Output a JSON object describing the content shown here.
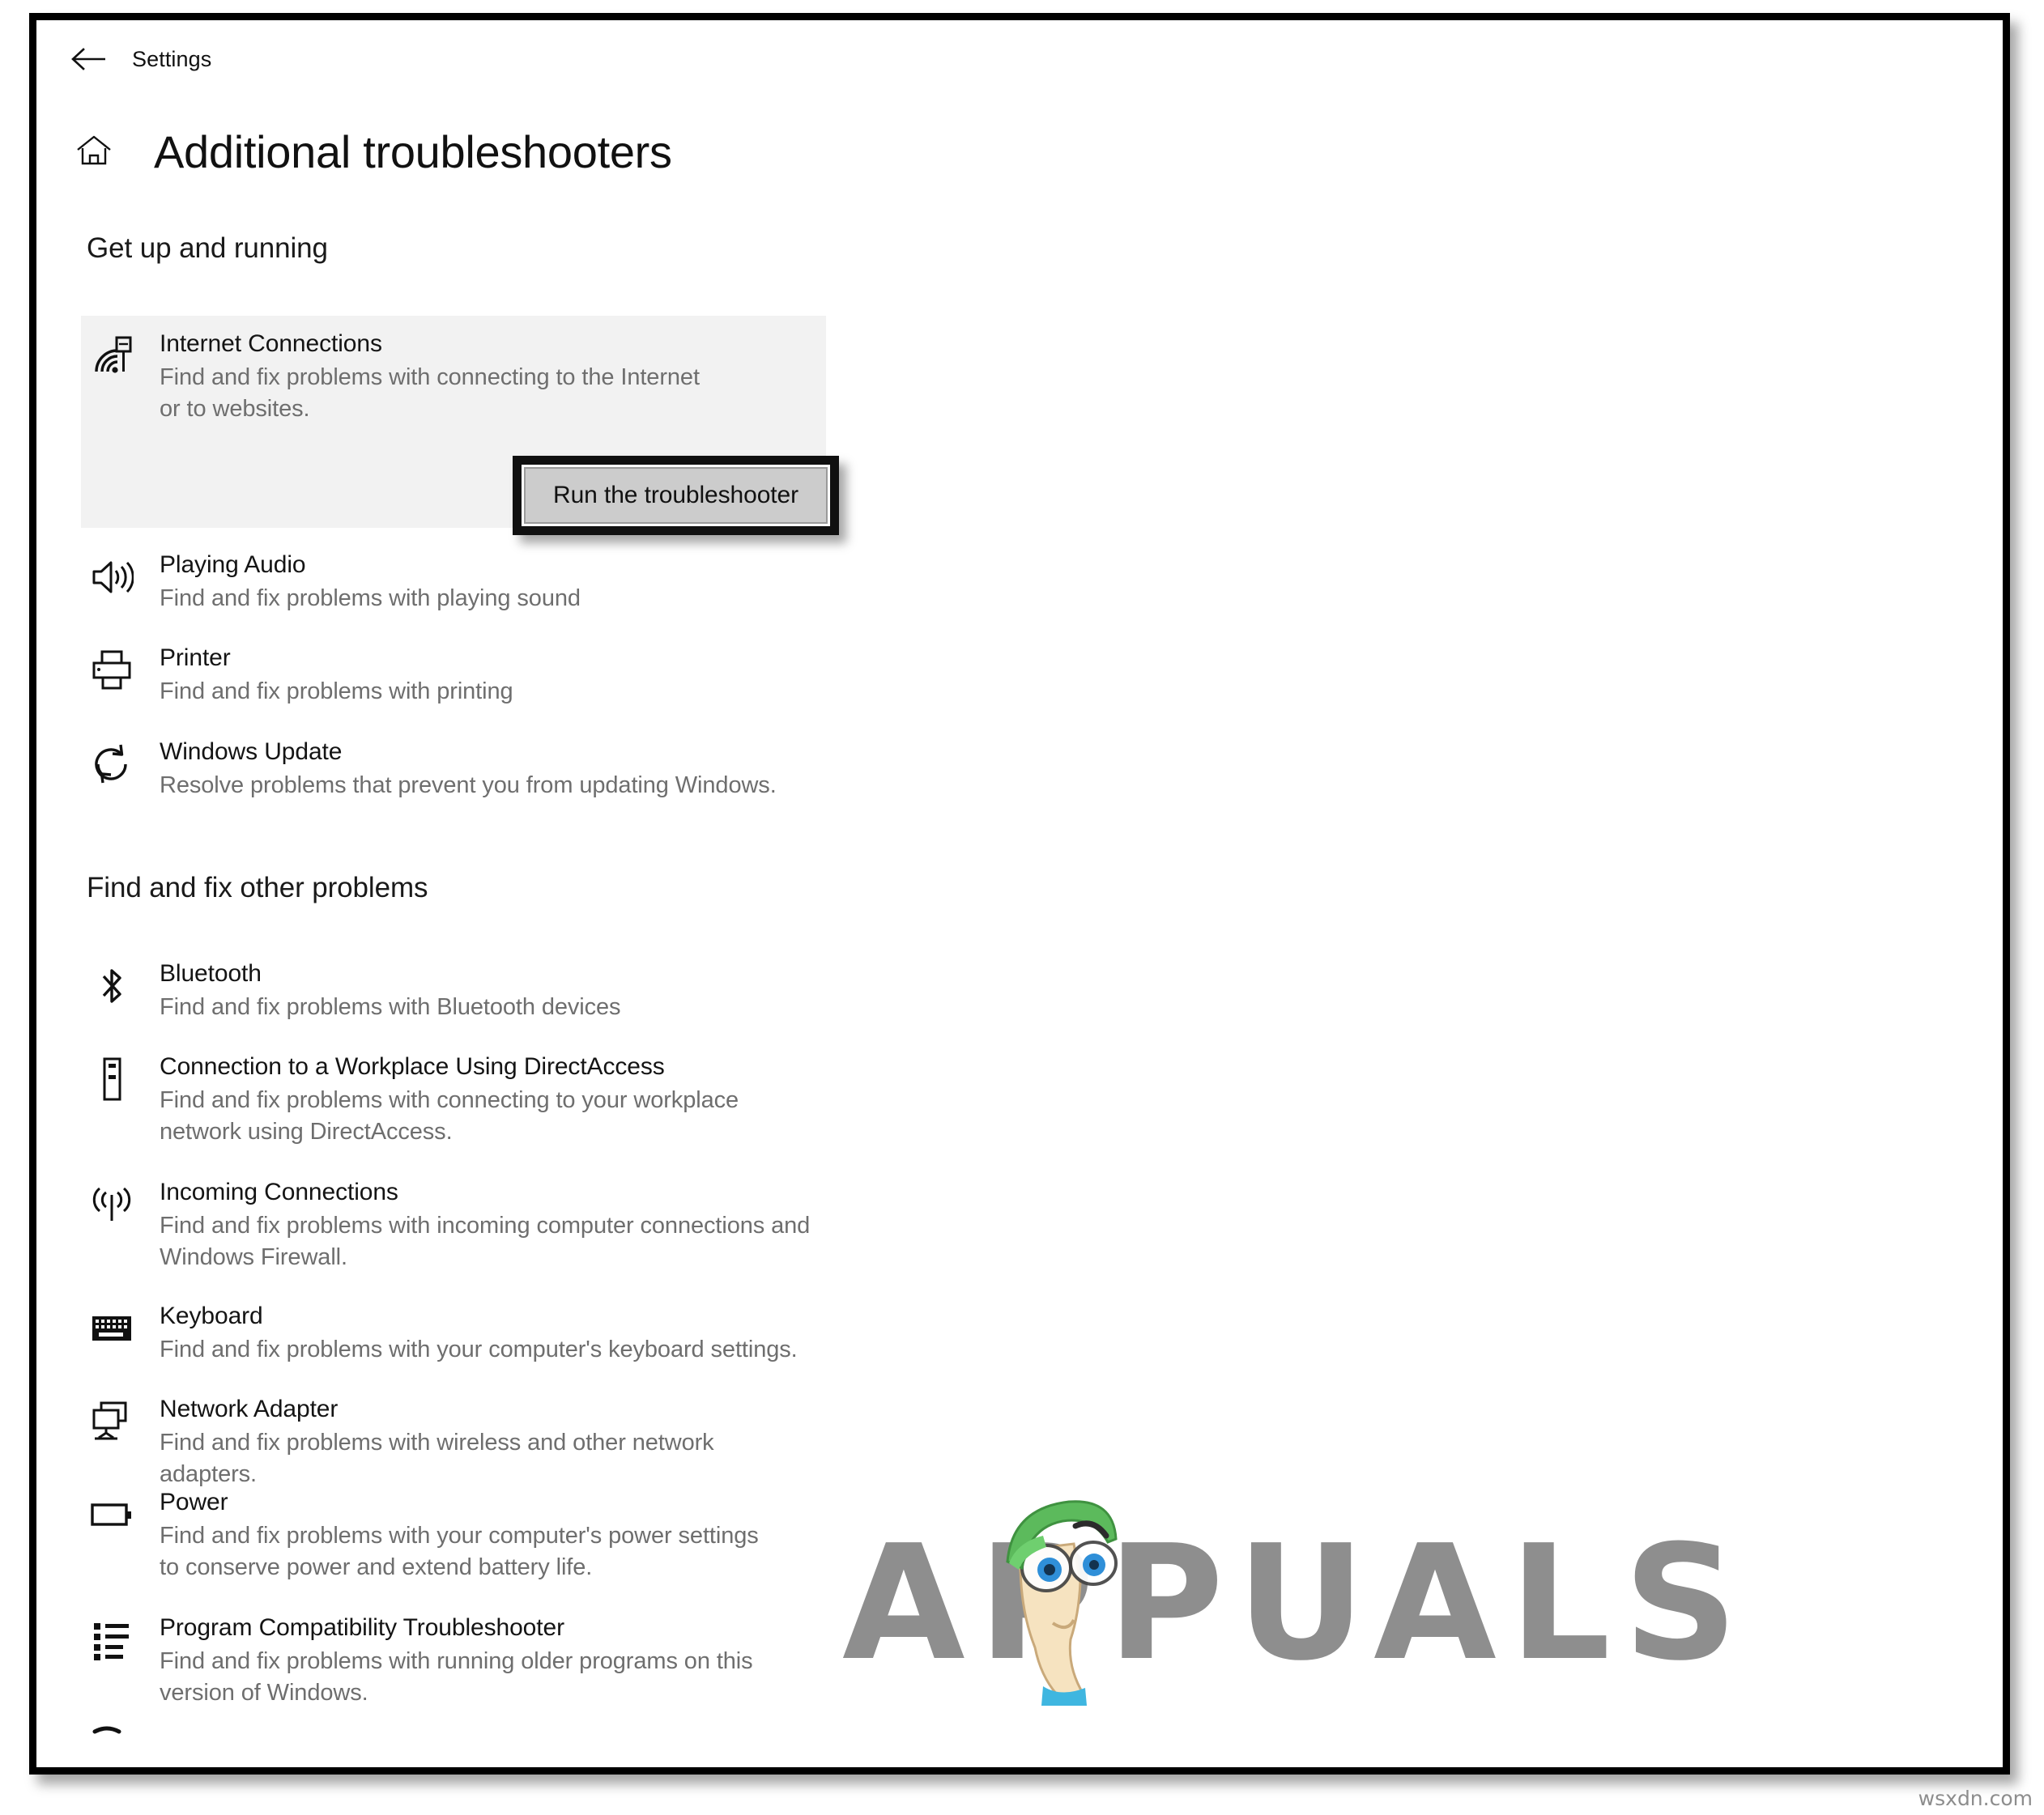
{
  "window": {
    "titlebar_label": "Settings",
    "back_icon": "arrow-left-icon",
    "home_icon": "home-icon",
    "page_title": "Additional troubleshooters"
  },
  "sections": [
    {
      "id": "get-up-and-running",
      "heading": "Get up and running",
      "items": [
        {
          "icon": "internet-connections-icon",
          "title": "Internet Connections",
          "desc": "Find and fix problems with connecting to the Internet or to websites.",
          "selected": true,
          "button_label": "Run the troubleshooter"
        },
        {
          "icon": "speaker-icon",
          "title": "Playing Audio",
          "desc": "Find and fix problems with playing sound"
        },
        {
          "icon": "printer-icon",
          "title": "Printer",
          "desc": "Find and fix problems with printing"
        },
        {
          "icon": "refresh-icon",
          "title": "Windows Update",
          "desc": "Resolve problems that prevent you from updating Windows."
        }
      ]
    },
    {
      "id": "find-and-fix-other-problems",
      "heading": "Find and fix other problems",
      "items": [
        {
          "icon": "bluetooth-icon",
          "title": "Bluetooth",
          "desc": "Find and fix problems with Bluetooth devices"
        },
        {
          "icon": "workplace-device-icon",
          "title": "Connection to a Workplace Using DirectAccess",
          "desc": "Find and fix problems with connecting to your workplace network using DirectAccess."
        },
        {
          "icon": "incoming-connections-icon",
          "title": "Incoming Connections",
          "desc": "Find and fix problems with incoming computer connections and Windows Firewall."
        },
        {
          "icon": "keyboard-icon",
          "title": "Keyboard",
          "desc": "Find and fix problems with your computer's keyboard settings."
        },
        {
          "icon": "network-adapter-icon",
          "title": "Network Adapter",
          "desc": "Find and fix problems with wireless and other network adapters."
        },
        {
          "icon": "battery-icon",
          "title": "Power",
          "desc": "Find and fix problems with your computer's power settings to conserve power and extend battery life."
        },
        {
          "icon": "list-icon",
          "title": "Program Compatibility Troubleshooter",
          "desc": "Find and fix problems with running older programs on this version of Windows."
        }
      ]
    }
  ],
  "watermark": {
    "brand": "APPUALS",
    "mascot": "appuals-mascot-icon",
    "site": "wsxdn.com"
  },
  "colors": {
    "card_background": "#f2f2f2",
    "button_face": "#cccccc",
    "focus_outline": "#101010",
    "title_text": "#141414",
    "desc_text": "#6e6e6e",
    "watermark_gray": "#8e8e8e",
    "mascot_hat_green": "#5cba5c",
    "mascot_skin": "#f6e3c0",
    "mascot_eye_blue": "#2f8fd8"
  }
}
